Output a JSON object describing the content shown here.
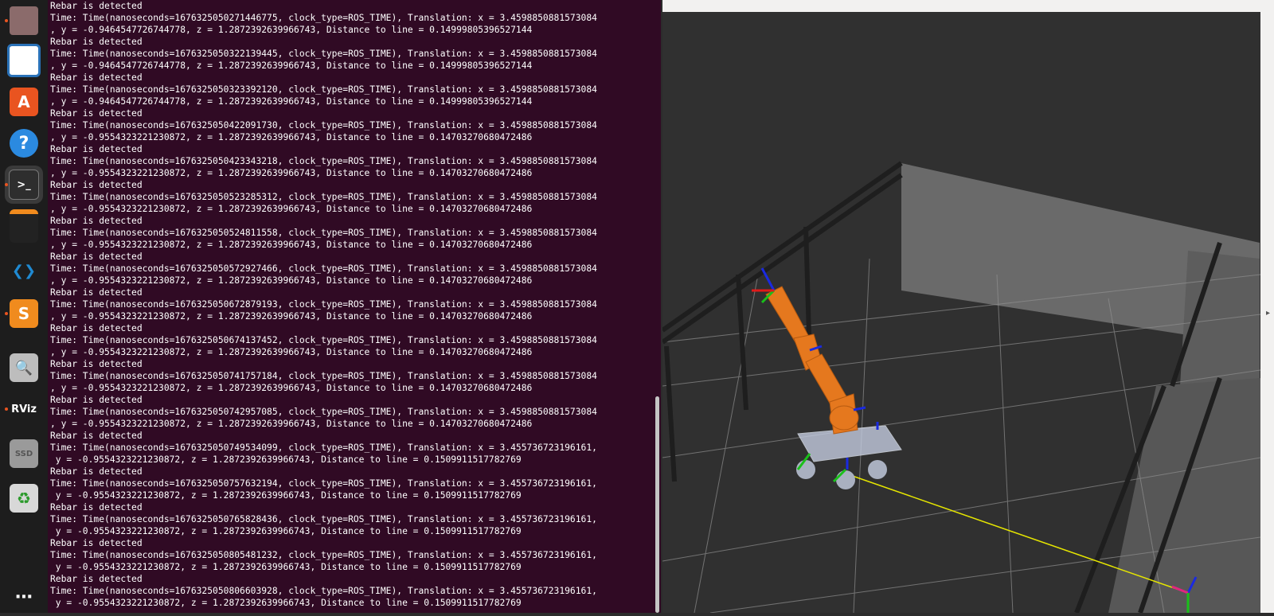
{
  "dock": {
    "items": [
      {
        "name": "files-icon",
        "color": "#8b6b6b",
        "active": false,
        "running": true
      },
      {
        "name": "libreoffice-impress-icon",
        "color": "#2a72b8",
        "active": false,
        "running": false
      },
      {
        "name": "software-center-icon",
        "color": "#e95420",
        "active": false,
        "running": false
      },
      {
        "name": "help-icon",
        "color": "#2b8ae0",
        "active": false,
        "running": false
      },
      {
        "name": "terminal-icon",
        "color": "#2e2e2e",
        "active": true,
        "running": true
      },
      {
        "name": "box-app-icon",
        "color": "#f08b1e",
        "active": false,
        "running": false
      },
      {
        "name": "vscode-icon",
        "color": "#1f8ad2",
        "active": false,
        "running": false
      },
      {
        "name": "sublime-text-icon",
        "color": "#f08b1e",
        "active": false,
        "running": true
      },
      {
        "name": "image-viewer-icon",
        "color": "#bdbdbd",
        "active": false,
        "running": false
      },
      {
        "name": "rviz-icon",
        "color": "#ffffff",
        "active": false,
        "running": true
      },
      {
        "name": "ssd-drive-icon",
        "color": "#9a9a9a",
        "active": false,
        "running": false
      },
      {
        "name": "trash-icon",
        "color": "#d8d8d8",
        "active": false,
        "running": false
      },
      {
        "name": "show-apps-icon",
        "color": "#ffffff",
        "active": false,
        "running": false
      }
    ],
    "rviz_label": "RViz",
    "ssd_label": "SSD"
  },
  "terminal": {
    "lines": [
      "Rebar is detected",
      "Time: Time(nanoseconds=1676325050271446775, clock_type=ROS_TIME), Translation: x = 3.4598850881573084",
      ", y = -0.9464547726744778, z = 1.2872392639966743, Distance to line = 0.14999805396527144",
      "Rebar is detected",
      "Time: Time(nanoseconds=1676325050322139445, clock_type=ROS_TIME), Translation: x = 3.4598850881573084",
      ", y = -0.9464547726744778, z = 1.2872392639966743, Distance to line = 0.14999805396527144",
      "Rebar is detected",
      "Time: Time(nanoseconds=1676325050323392120, clock_type=ROS_TIME), Translation: x = 3.4598850881573084",
      ", y = -0.9464547726744778, z = 1.2872392639966743, Distance to line = 0.14999805396527144",
      "Rebar is detected",
      "Time: Time(nanoseconds=1676325050422091730, clock_type=ROS_TIME), Translation: x = 3.4598850881573084",
      ", y = -0.9554323221230872, z = 1.2872392639966743, Distance to line = 0.14703270680472486",
      "Rebar is detected",
      "Time: Time(nanoseconds=1676325050423343218, clock_type=ROS_TIME), Translation: x = 3.4598850881573084",
      ", y = -0.9554323221230872, z = 1.2872392639966743, Distance to line = 0.14703270680472486",
      "Rebar is detected",
      "Time: Time(nanoseconds=1676325050523285312, clock_type=ROS_TIME), Translation: x = 3.4598850881573084",
      ", y = -0.9554323221230872, z = 1.2872392639966743, Distance to line = 0.14703270680472486",
      "Rebar is detected",
      "Time: Time(nanoseconds=1676325050524811558, clock_type=ROS_TIME), Translation: x = 3.4598850881573084",
      ", y = -0.9554323221230872, z = 1.2872392639966743, Distance to line = 0.14703270680472486",
      "Rebar is detected",
      "Time: Time(nanoseconds=1676325050572927466, clock_type=ROS_TIME), Translation: x = 3.4598850881573084",
      ", y = -0.9554323221230872, z = 1.2872392639966743, Distance to line = 0.14703270680472486",
      "Rebar is detected",
      "Time: Time(nanoseconds=1676325050672879193, clock_type=ROS_TIME), Translation: x = 3.4598850881573084",
      ", y = -0.9554323221230872, z = 1.2872392639966743, Distance to line = 0.14703270680472486",
      "Rebar is detected",
      "Time: Time(nanoseconds=1676325050674137452, clock_type=ROS_TIME), Translation: x = 3.4598850881573084",
      ", y = -0.9554323221230872, z = 1.2872392639966743, Distance to line = 0.14703270680472486",
      "Rebar is detected",
      "Time: Time(nanoseconds=1676325050741757184, clock_type=ROS_TIME), Translation: x = 3.4598850881573084",
      ", y = -0.9554323221230872, z = 1.2872392639966743, Distance to line = 0.14703270680472486",
      "Rebar is detected",
      "Time: Time(nanoseconds=1676325050742957085, clock_type=ROS_TIME), Translation: x = 3.4598850881573084",
      ", y = -0.9554323221230872, z = 1.2872392639966743, Distance to line = 0.14703270680472486",
      "Rebar is detected",
      "Time: Time(nanoseconds=1676325050749534099, clock_type=ROS_TIME), Translation: x = 3.455736723196161,",
      " y = -0.9554323221230872, z = 1.2872392639966743, Distance to line = 0.1509911517782769",
      "Rebar is detected",
      "Time: Time(nanoseconds=1676325050757632194, clock_type=ROS_TIME), Translation: x = 3.455736723196161,",
      " y = -0.9554323221230872, z = 1.2872392639966743, Distance to line = 0.1509911517782769",
      "Rebar is detected",
      "Time: Time(nanoseconds=1676325050765828436, clock_type=ROS_TIME), Translation: x = 3.455736723196161,",
      " y = -0.9554323221230872, z = 1.2872392639966743, Distance to line = 0.1509911517782769",
      "Rebar is detected",
      "Time: Time(nanoseconds=1676325050805481232, clock_type=ROS_TIME), Translation: x = 3.455736723196161,",
      " y = -0.9554323221230872, z = 1.2872392639966743, Distance to line = 0.1509911517782769",
      "Rebar is detected",
      "Time: Time(nanoseconds=1676325050806603928, clock_type=ROS_TIME), Translation: x = 3.455736723196161,",
      " y = -0.9554323221230872, z = 1.2872392639966743, Distance to line = 0.1509911517782769"
    ]
  },
  "rviz": {
    "background": "#303030",
    "robot_color": "#e5781e",
    "grid_color": "#a0a0a0",
    "path_line_color": "#e6e600"
  }
}
